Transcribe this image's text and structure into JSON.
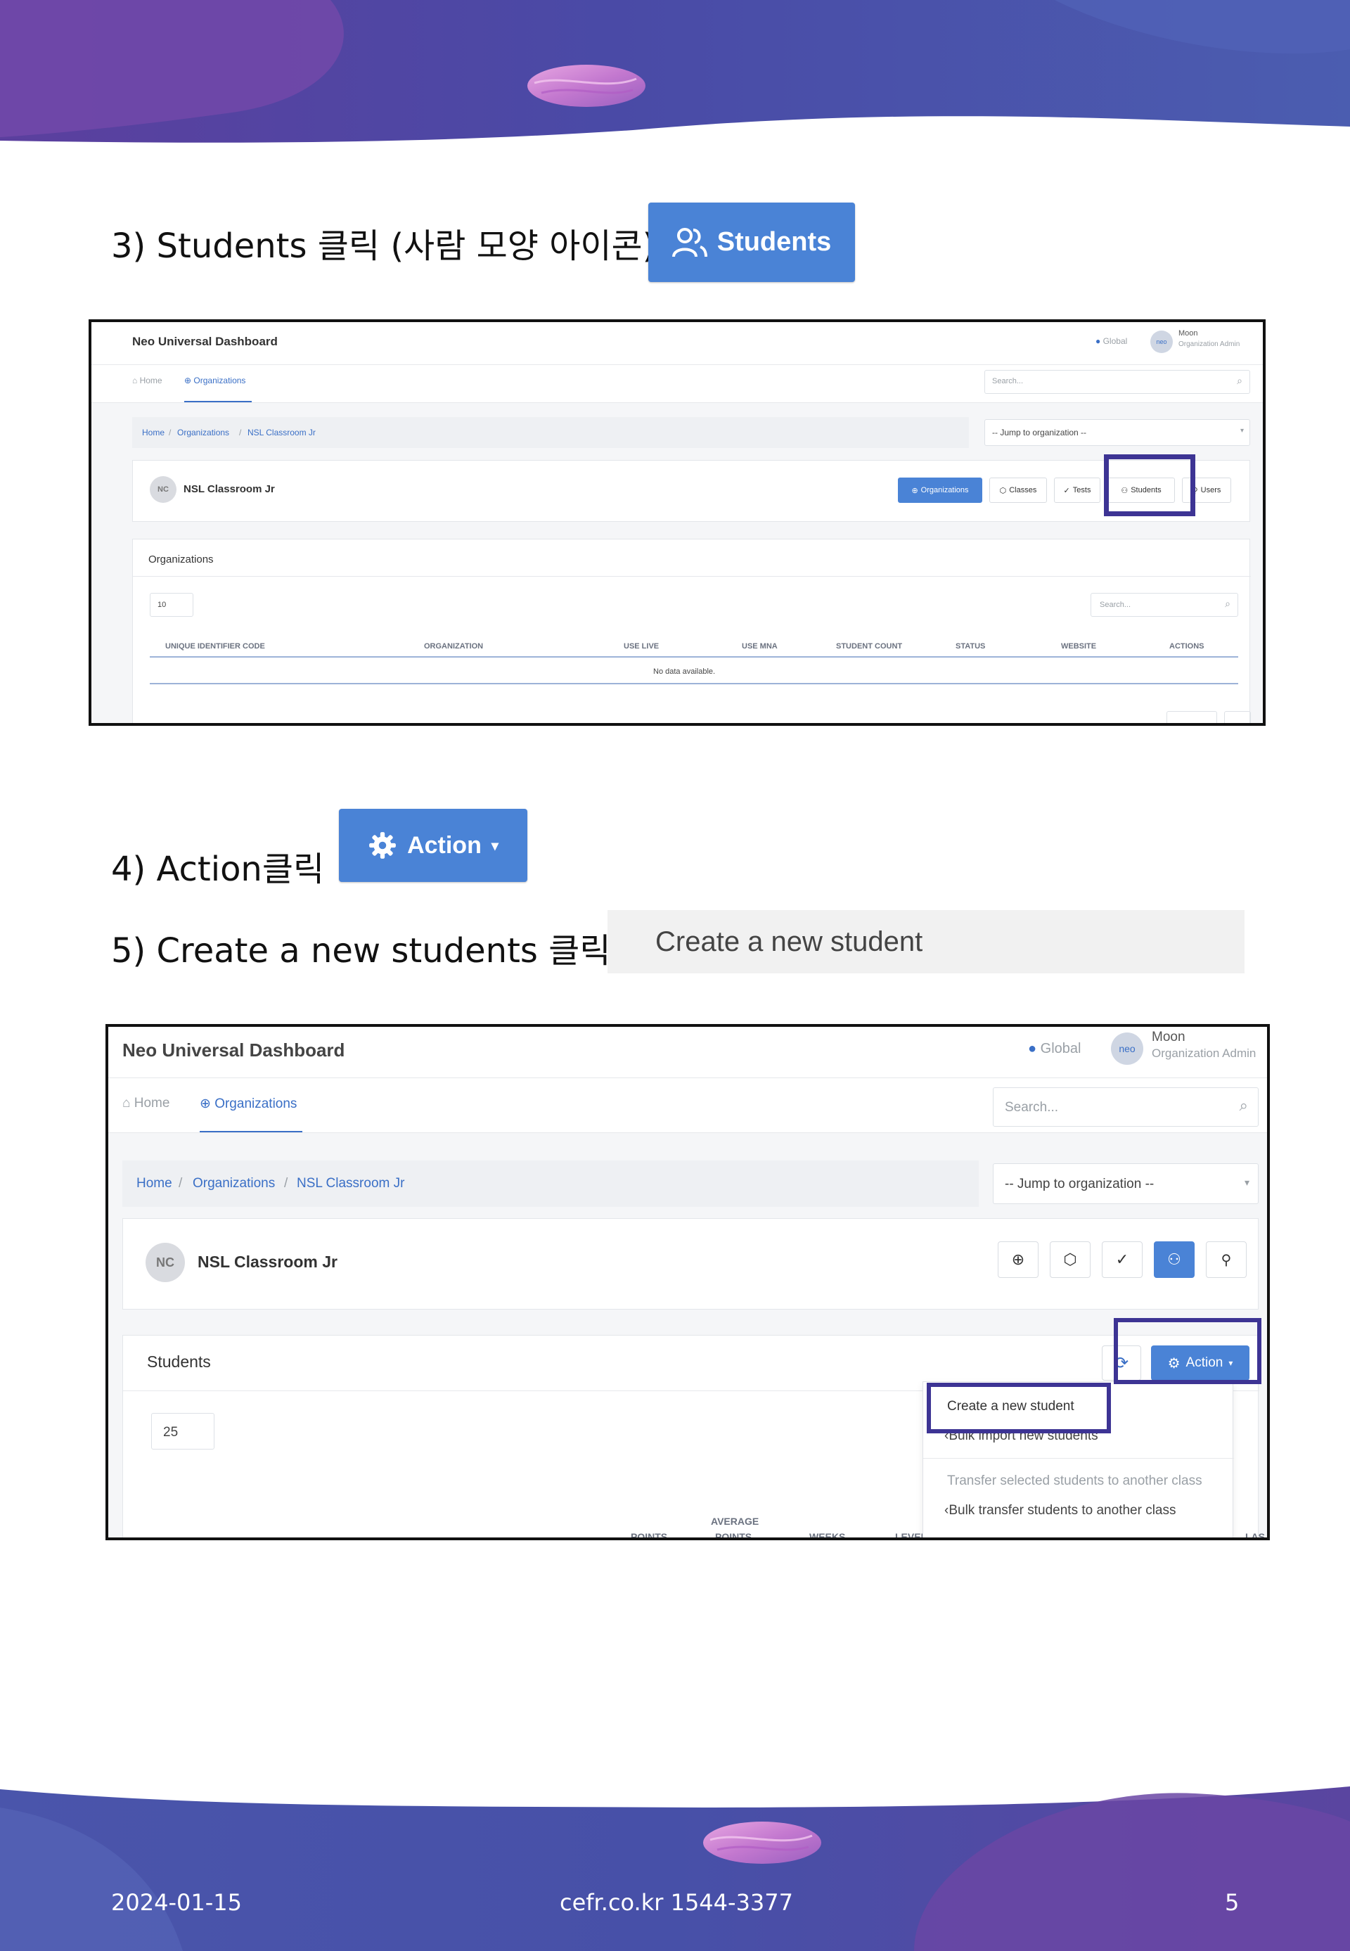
{
  "steps": {
    "step3": "3) Students 클릭 (사람 모양 아이콘)",
    "step4": "4) Action클릭",
    "step5": "5) Create a new students 클릭"
  },
  "samples": {
    "students_button": "Students",
    "action_button": "Action",
    "create_bar": "Create a new student"
  },
  "shot1": {
    "app_title": "Neo Universal Dashboard",
    "global_label": "Global",
    "user_name": "Moon",
    "user_role": "Organization Admin",
    "avatar_text": "neo",
    "nav_home": "Home",
    "nav_organizations": "Organizations",
    "search_placeholder": "Search...",
    "breadcrumb": [
      "Home",
      "Organizations",
      "NSL Classroom Jr"
    ],
    "jump_select": "-- Jump to organization --",
    "org_initials": "NC",
    "org_name": "NSL Classroom Jr",
    "tabs": [
      "Organizations",
      "Classes",
      "Tests",
      "Students",
      "Users"
    ],
    "panel_title": "Organizations",
    "page_size": "10",
    "table_search": "Search...",
    "columns": [
      "UNIQUE IDENTIFIER CODE",
      "ORGANIZATION",
      "USE LIVE",
      "USE MNA",
      "STUDENT COUNT",
      "STATUS",
      "WEBSITE",
      "ACTIONS"
    ],
    "empty_text": "No data available."
  },
  "shot2": {
    "app_title": "Neo Universal Dashboard",
    "global_label": "Global",
    "user_name": "Moon",
    "user_role": "Organization Admin",
    "avatar_text": "neo",
    "nav_home": "Home",
    "nav_organizations": "Organizations",
    "search_placeholder": "Search...",
    "breadcrumb": [
      "Home",
      "Organizations",
      "NSL Classroom Jr"
    ],
    "jump_select": "-- Jump to organization --",
    "org_initials": "NC",
    "org_name": "NSL Classroom Jr",
    "panel_title": "Students",
    "page_size": "25",
    "action_label": "Action",
    "menu": [
      "Create a new student",
      "Bulk import new students",
      "Transfer selected students to another class",
      "Bulk transfer students to another class"
    ],
    "columns_partial": [
      "POINTS",
      "AVERAGE",
      "POINTS",
      "WEEKS",
      "LEVEL",
      "LAS"
    ]
  },
  "footer": {
    "date": "2024-01-15",
    "site_phone": "cefr.co.kr   1544-3377",
    "page": "5"
  },
  "colors": {
    "brand_blue": "#4a83d6",
    "highlight": "#3d3494",
    "wave_dark": "#3f4ca3",
    "wave_purple": "#6a47a4"
  }
}
